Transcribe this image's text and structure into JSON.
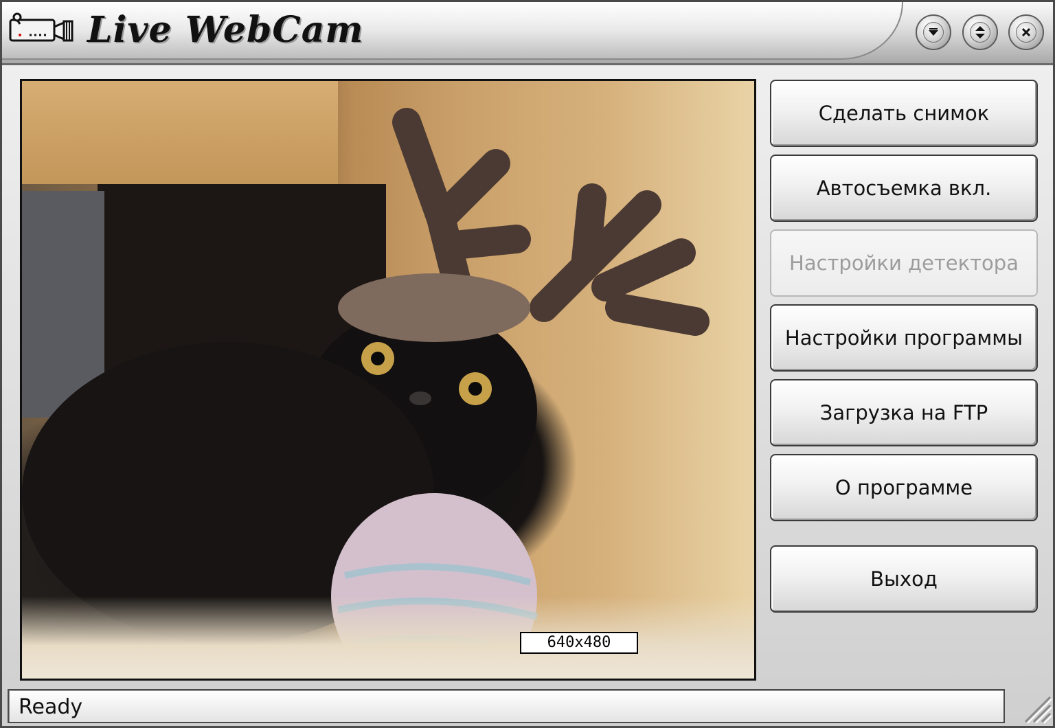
{
  "window": {
    "title": "Live WebCam",
    "controls": {
      "minimize_icon": "chevron-down-icon",
      "maximize_icon": "up-down-arrows-icon",
      "close_icon": "close-icon"
    }
  },
  "video": {
    "resolution_label": "640x480"
  },
  "buttons": [
    {
      "label": "Сделать снимок",
      "enabled": true
    },
    {
      "label": "Автосъемка вкл.",
      "enabled": true
    },
    {
      "label": "Настройки детектора",
      "enabled": false
    },
    {
      "label": "Настройки программы",
      "enabled": true
    },
    {
      "label": "Загрузка на FTP",
      "enabled": true
    },
    {
      "label": "О программе",
      "enabled": true
    },
    {
      "label": "Выход",
      "enabled": true
    }
  ],
  "status": {
    "text": "Ready"
  },
  "colors": {
    "button_text": "#111111",
    "disabled_text": "#9c9c9c",
    "frame": "#4a4a4a"
  }
}
